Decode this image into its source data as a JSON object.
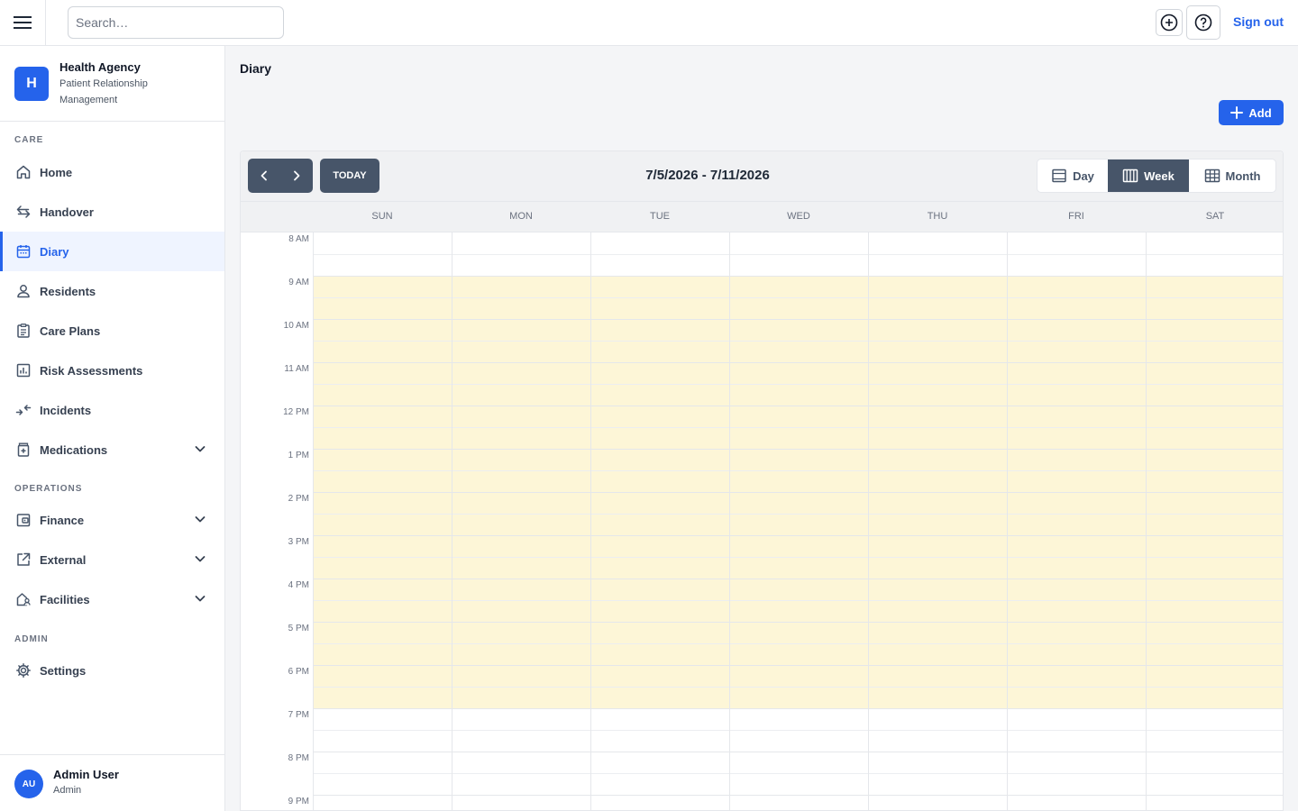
{
  "topbar": {
    "search_placeholder": "Search…",
    "sign_out": "Sign out"
  },
  "brand": {
    "initial": "H",
    "name": "Health Agency",
    "subtitle": "Patient Relationship Management"
  },
  "sidebar": {
    "sections": [
      {
        "title": "CARE"
      },
      {
        "title": "OPERATIONS"
      },
      {
        "title": "ADMIN"
      }
    ],
    "items": [
      {
        "label": "Home",
        "icon": "home-icon"
      },
      {
        "label": "Handover",
        "icon": "arrows-exchange-icon"
      },
      {
        "label": "Diary",
        "icon": "calendar-icon",
        "active": true
      },
      {
        "label": "Residents",
        "icon": "user-icon"
      },
      {
        "label": "Care Plans",
        "icon": "clipboard-icon"
      },
      {
        "label": "Risk Assessments",
        "icon": "chart-icon"
      },
      {
        "label": "Incidents",
        "icon": "arrows-in-icon"
      },
      {
        "label": "Medications",
        "icon": "medicine-icon",
        "expandable": true
      },
      {
        "label": "Finance",
        "icon": "wallet-icon",
        "expandable": true
      },
      {
        "label": "External",
        "icon": "external-link-icon",
        "expandable": true
      },
      {
        "label": "Facilities",
        "icon": "building-icon",
        "expandable": true
      },
      {
        "label": "Settings",
        "icon": "gear-icon"
      }
    ]
  },
  "user": {
    "initials": "AU",
    "name": "Admin User",
    "role": "Admin"
  },
  "main": {
    "title": "Diary",
    "add_label": "Add"
  },
  "calendar": {
    "today_label": "TODAY",
    "range": "7/5/2026 - 7/11/2026",
    "views": [
      {
        "label": "Day",
        "active": false
      },
      {
        "label": "Week",
        "active": true
      },
      {
        "label": "Month",
        "active": false
      }
    ],
    "days": [
      "SUN",
      "MON",
      "TUE",
      "WED",
      "THU",
      "FRI",
      "SAT"
    ],
    "times": [
      "8 AM",
      "9 AM",
      "10 AM",
      "11 AM",
      "12 PM",
      "1 PM",
      "2 PM",
      "3 PM",
      "4 PM",
      "5 PM",
      "6 PM",
      "7 PM",
      "8 PM",
      "9 PM"
    ],
    "business_hours": {
      "start": "9 AM",
      "end": "7 PM"
    }
  },
  "colors": {
    "accent": "#2563eb",
    "slate": "#475569",
    "business_hours_bg": "#fdf6d7"
  }
}
